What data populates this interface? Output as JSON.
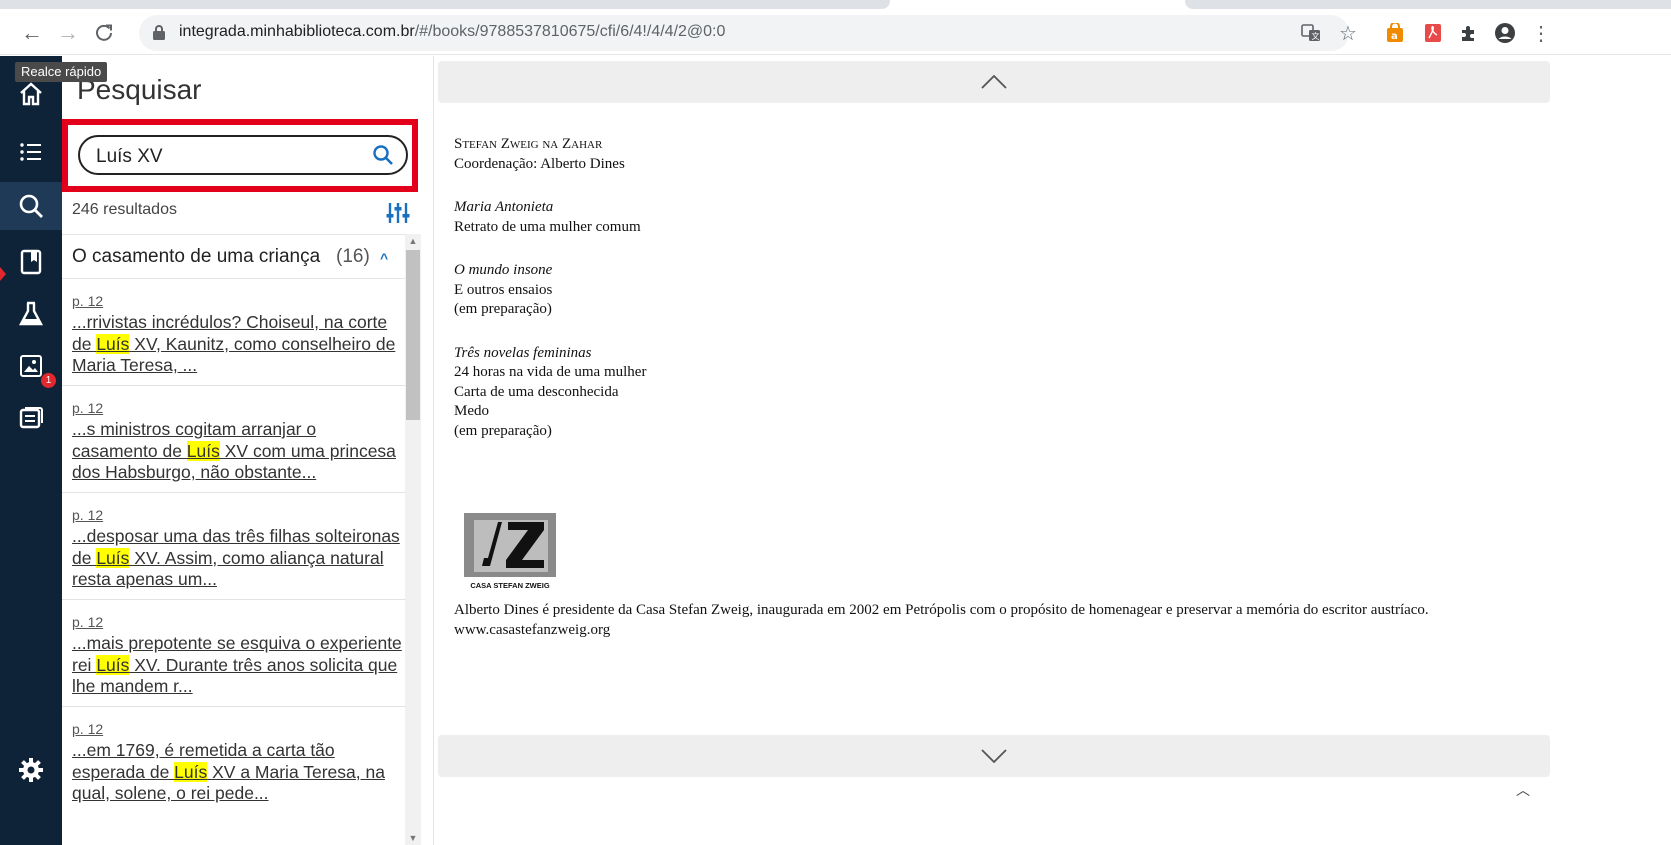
{
  "browser": {
    "url_host": "integrada.minhabiblioteca.com.br",
    "url_rest": "/#/books/9788537810675/cfi/6/4!/4/4/2@0:0"
  },
  "tooltip": "Realce rápido",
  "rail": {
    "badge_count": "1"
  },
  "search": {
    "title": "Pesquisar",
    "query": "Luís XV",
    "result_count": "246 resultados",
    "group": {
      "title": "O casamento de uma criança",
      "count": "(16)"
    },
    "hits": [
      {
        "page": "p. 12",
        "before": "...rrivistas incrédulos? Choiseul, na corte de ",
        "match": "Luís",
        "after": " XV, Kaunitz, como conselheiro de Maria Teresa, ..."
      },
      {
        "page": "p. 12",
        "before": "...s ministros cogitam arranjar o casamento de ",
        "match": "Luís",
        "after": " XV com uma princesa dos Habsburgo, não obstante..."
      },
      {
        "page": "p. 12",
        "before": "...desposar uma das três filhas solteironas de ",
        "match": "Luís",
        "after": " XV. Assim, como aliança natural resta apenas um..."
      },
      {
        "page": "p. 12",
        "before": "...mais prepotente se esquiva o experiente rei ",
        "match": "Luís",
        "after": " XV. Durante três anos solicita que lhe mandem r..."
      },
      {
        "page": "p. 12",
        "before": "...em 1769, é remetida a carta tão esperada de ",
        "match": "Luís",
        "after": " XV a Maria Teresa, na qual, solene, o rei pede..."
      }
    ]
  },
  "reader": {
    "series_title": "Stefan Zweig na Zahar",
    "coordination": "Coordenação: Alberto Dines",
    "books": [
      {
        "title": "Maria Antonieta",
        "lines": [
          "Retrato de uma mulher comum"
        ]
      },
      {
        "title": "O mundo insone",
        "lines": [
          "E outros ensaios",
          "(em preparação)"
        ]
      },
      {
        "title": "Três novelas femininas",
        "lines": [
          "24 horas na vida de uma mulher",
          "Carta de uma desconhecida",
          "Medo",
          "(em preparação)"
        ]
      }
    ],
    "logo_caption": "CASA STEFAN ZWEIG",
    "bio": "Alberto Dines é presidente da Casa Stefan Zweig, inaugurada em 2002 em Petrópolis com o propósito de homenagear e preservar a memória do escritor austríaco.",
    "website": "www.casastefanzweig.org"
  },
  "colors": {
    "rail_bg": "#0f2338",
    "highlight_box": "#e3001b",
    "match_highlight": "#ffff00",
    "accent": "#1a6fbf"
  }
}
